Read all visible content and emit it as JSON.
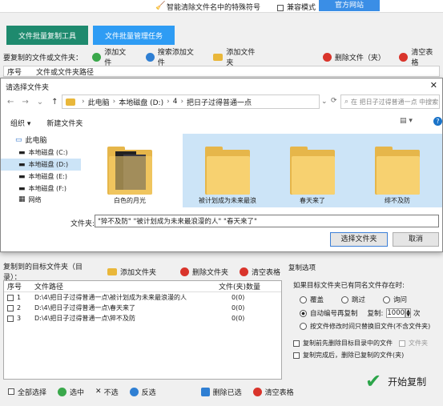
{
  "titlebar": {
    "center": "智能清除文件名中的特殊符号",
    "compat": "兼容模式",
    "site": "官方网站"
  },
  "mode_tabs": [
    "文件批量复制工具",
    "文件批量管理任务"
  ],
  "src_toolbar": {
    "label": "要复制的文件或文件夹：",
    "add_file": "添加文件",
    "search_add": "搜索添加文件",
    "add_folder": "添加文件夹",
    "delete": "删除文件（夹）",
    "clear": "清空表格"
  },
  "src_table": {
    "col_no": "序号",
    "col_path": "文件或文件夹路径"
  },
  "dialog": {
    "title": "请选择文件夹",
    "breadcrumb": [
      "此电脑",
      "本地磁盘 (D:)",
      "4",
      "把日子过得普通一点"
    ],
    "search_placeholder": "在 把日子过得普通一点 中搜索",
    "organize": "组织 ▾",
    "new_folder": "新建文件夹",
    "nav": [
      "此电脑",
      "本地磁盘 (C:)",
      "本地磁盘 (D:)",
      "本地磁盘 (E:)",
      "本地磁盘 (F:)",
      "网络"
    ],
    "items": [
      {
        "label": "白色的月光",
        "selected": false,
        "photo": true
      },
      {
        "label": "被计划成为未来最浪",
        "selected": true
      },
      {
        "label": "春天来了",
        "selected": true
      },
      {
        "label": "绯不及防",
        "selected": true
      }
    ],
    "filename_label": "文件夹:",
    "filename_value": "\"猝不及防\" \"被计划成为未来最浪漫的人\" \"春天来了\"",
    "ok": "选择文件夹",
    "cancel": "取消"
  },
  "dest_toolbar": {
    "label": "复制到的目标文件夹（目录）：",
    "add_folder": "添加文件夹",
    "delete": "删除文件夹",
    "clear": "清空表格"
  },
  "dest_table": {
    "col_no": "序号",
    "col_path": "文件路径",
    "col_count": "文件(夹)数量",
    "rows": [
      {
        "no": "1",
        "path": "D:\\4\\把日子过得普通一点\\被计划成为未来最浪漫的人",
        "count": "0(0)"
      },
      {
        "no": "2",
        "path": "D:\\4\\把日子过得普通一点\\春天来了",
        "count": "0(0)"
      },
      {
        "no": "3",
        "path": "D:\\4\\把日子过得普通一点\\猝不及防",
        "count": "0(0)"
      }
    ]
  },
  "bottom_bar": {
    "select_all": "全部选择",
    "select": "选中",
    "deselect": "不选",
    "invert": "反选",
    "delete_selected": "删除已选",
    "clear": "清空表格"
  },
  "options": {
    "title": "复制选项",
    "question": "如果目标文件夹已有同名文件存在时:",
    "overwrite": "覆盖",
    "skip": "跳过",
    "ask": "询问",
    "auto_number": "自动编号再复制",
    "copies_label": "复制:",
    "copies_value": "1000",
    "copies_unit": "次",
    "replace_by_time": "按文件修改时间只替换旧文件(不含文件夹)",
    "clear_target": "复制前先删除目标目录中的文件",
    "file_only": "文件夹",
    "delete_after": "复制完成后，删除已复制的文件(夹)"
  },
  "start": "开始复制"
}
